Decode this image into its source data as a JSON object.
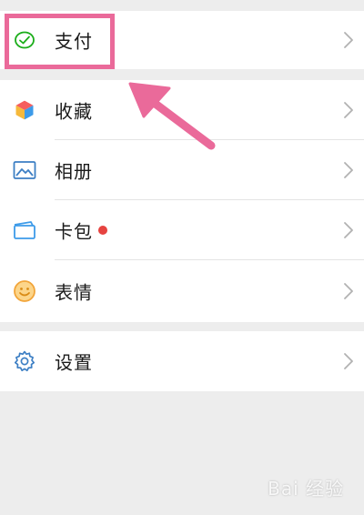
{
  "menu": {
    "payment": {
      "label": "支付",
      "icon": "payment-check-icon"
    },
    "items": [
      {
        "key": "favorites",
        "label": "收藏",
        "icon": "cube-icon"
      },
      {
        "key": "album",
        "label": "相册",
        "icon": "picture-icon"
      },
      {
        "key": "card-wallet",
        "label": "卡包",
        "icon": "card-icon",
        "has_badge": true
      },
      {
        "key": "stickers",
        "label": "表情",
        "icon": "smiley-icon"
      }
    ],
    "settings": {
      "label": "设置",
      "icon": "gear-icon"
    }
  },
  "watermark": {
    "text": "Bai 经验"
  },
  "colors": {
    "highlight": "#ea6a9a",
    "badge": "#e64340",
    "payment_green": "#1aad19",
    "icon_blue": "#3d7fc4",
    "smiley_orange": "#f2a53a"
  }
}
